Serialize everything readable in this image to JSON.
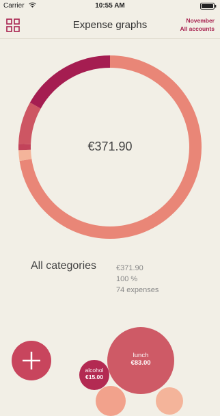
{
  "status_bar": {
    "carrier": "Carrier",
    "time": "10:55 AM"
  },
  "header": {
    "title": "Expense graphs",
    "period": "November",
    "accounts": "All accounts"
  },
  "donut": {
    "total": "€371.90",
    "segments": [
      {
        "value": 270.0,
        "color": "#e98677"
      },
      {
        "value": 7.0,
        "color": "#f4b49a"
      },
      {
        "value": 4.0,
        "color": "#c2435a"
      },
      {
        "value": 28.0,
        "color": "#cd5663"
      },
      {
        "value": 62.9,
        "color": "#a51d51"
      }
    ]
  },
  "summary": {
    "label": "All categories",
    "amount": "€371.90",
    "percent": "100 %",
    "expenses": "74 expenses"
  },
  "bubbles": {
    "lunch": {
      "name": "lunch",
      "amount": "€83.00"
    },
    "alcohol": {
      "name": "alcohol",
      "amount": "€15.00"
    }
  },
  "colors": {
    "accent": "#a7204e",
    "background": "#f2efe6"
  }
}
